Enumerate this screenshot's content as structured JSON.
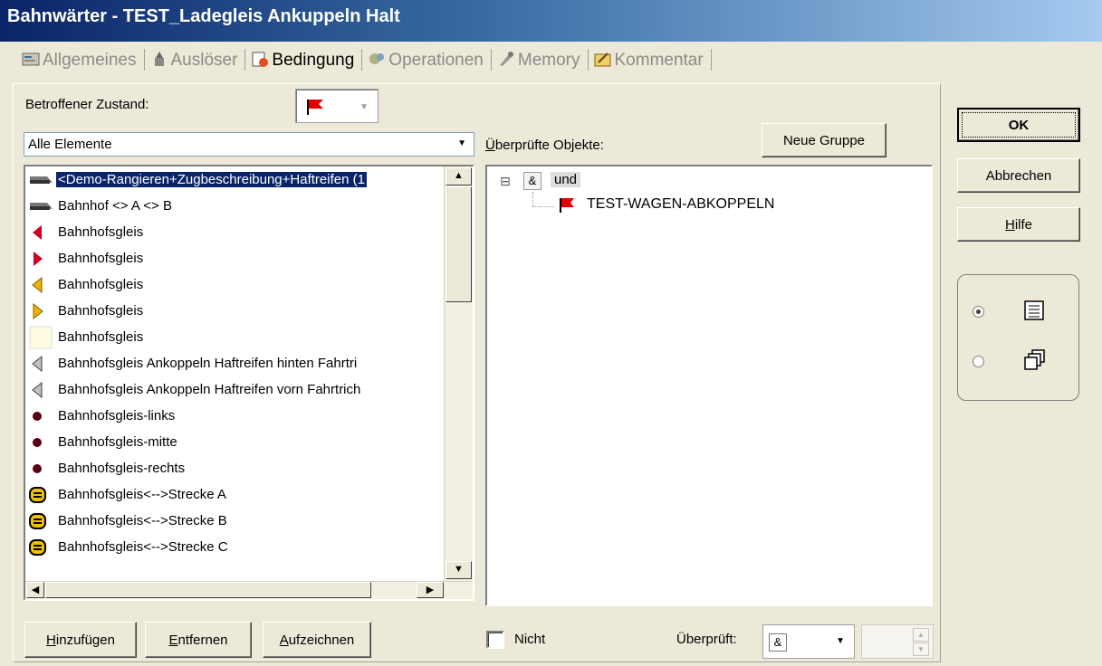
{
  "window": {
    "title": "Bahnwärter - TEST_Ladegleis Ankuppeln Halt"
  },
  "tabs": [
    {
      "label": "Allgemeines",
      "icon": "general-icon",
      "active": false
    },
    {
      "label": "Auslöser",
      "icon": "trigger-icon",
      "active": false
    },
    {
      "label": "Bedingung",
      "icon": "condition-icon",
      "active": true
    },
    {
      "label": "Operationen",
      "icon": "operations-icon",
      "active": false
    },
    {
      "label": "Memory",
      "icon": "memory-icon",
      "active": false
    },
    {
      "label": "Kommentar",
      "icon": "comment-icon",
      "active": false
    }
  ],
  "condition": {
    "state_label": "Betroffener Zustand:",
    "state_icon": "red-flag-icon",
    "filter_value": "Alle Elemente",
    "checked_objects_label": "Überprüfte Objekte:",
    "new_group_button": "Neue Gruppe",
    "elements": [
      {
        "label": "<Demo-Rangieren+Zugbeschreibung+Haftreifen (1",
        "icon": "train-icon",
        "selected": true
      },
      {
        "label": "Bahnhof <> A <> B",
        "icon": "train-icon"
      },
      {
        "label": "Bahnhofsgleis",
        "icon": "triangle-left-red-icon"
      },
      {
        "label": "Bahnhofsgleis",
        "icon": "triangle-right-red-icon"
      },
      {
        "label": "Bahnhofsgleis",
        "icon": "triangle-left-yellow-icon"
      },
      {
        "label": "Bahnhofsgleis",
        "icon": "triangle-right-yellow-icon"
      },
      {
        "label": "Bahnhofsgleis",
        "icon": "box-icon"
      },
      {
        "label": "Bahnhofsgleis  Ankoppeln Haftreifen hinten Fahrtri",
        "icon": "triangle-left-gray-icon"
      },
      {
        "label": "Bahnhofsgleis  Ankoppeln Haftreifen vorn Fahrtrich",
        "icon": "triangle-left-gray-icon"
      },
      {
        "label": "Bahnhofsgleis-links",
        "icon": "circle-icon"
      },
      {
        "label": "Bahnhofsgleis-mitte",
        "icon": "circle-icon"
      },
      {
        "label": "Bahnhofsgleis-rechts",
        "icon": "circle-icon"
      },
      {
        "label": "Bahnhofsgleis<-->Strecke A",
        "icon": "track-icon"
      },
      {
        "label": "Bahnhofsgleis<-->Strecke B",
        "icon": "track-icon"
      },
      {
        "label": "Bahnhofsgleis<-->Strecke C",
        "icon": "track-icon"
      }
    ],
    "tree": {
      "root_symbol": "&",
      "root_label": "und",
      "children": [
        {
          "label": "TEST-WAGEN-ABKOPPELN",
          "icon": "red-flag-icon"
        }
      ]
    },
    "buttons": {
      "add": "Hinzufügen",
      "remove": "Entfernen",
      "record": "Aufzeichnen"
    },
    "not_label": "Nicht",
    "checked_label": "Überprüft:",
    "operator_value": "&"
  },
  "side": {
    "ok": "OK",
    "cancel": "Abbrechen",
    "help": "Hilfe",
    "view_options": [
      {
        "icon": "list-view-icon",
        "selected": true
      },
      {
        "icon": "windows-view-icon",
        "selected": false
      }
    ]
  },
  "colors": {
    "selection": "#0a246a",
    "flag": "#e00000",
    "dialog": "#ece9d8"
  }
}
